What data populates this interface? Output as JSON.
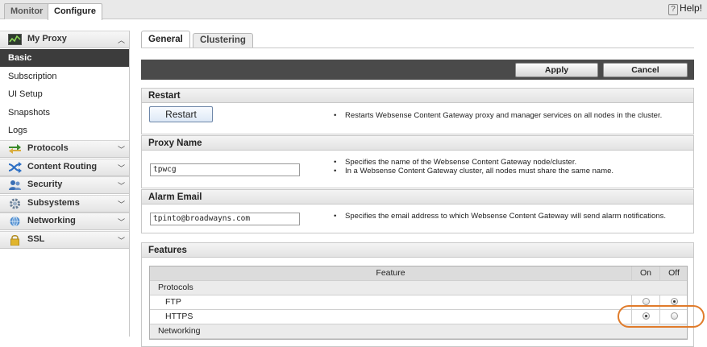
{
  "top_tabs": {
    "monitor": "Monitor",
    "configure": "Configure"
  },
  "help": {
    "label": "Help!"
  },
  "sidebar": {
    "my_proxy": "My Proxy",
    "items": [
      "Basic",
      "Subscription",
      "UI Setup",
      "Snapshots",
      "Logs"
    ],
    "sections": [
      "Protocols",
      "Content Routing",
      "Security",
      "Subsystems",
      "Networking",
      "SSL"
    ]
  },
  "tabs": {
    "general": "General",
    "clustering": "Clustering"
  },
  "toolbar": {
    "apply": "Apply",
    "cancel": "Cancel"
  },
  "restart": {
    "title": "Restart",
    "button": "Restart",
    "desc": "Restarts Websense Content Gateway proxy and manager services on all nodes in the cluster."
  },
  "proxy_name": {
    "title": "Proxy Name",
    "value": "tpwcg",
    "desc1": "Specifies the name of the Websense Content Gateway node/cluster.",
    "desc2": "In a Websense Content Gateway cluster, all nodes must share the same name."
  },
  "alarm_email": {
    "title": "Alarm Email",
    "value": "tpinto@broadwayns.com",
    "desc": "Specifies the email address to which Websense Content Gateway will send alarm notifications."
  },
  "features": {
    "title": "Features",
    "col_feature": "Feature",
    "col_on": "On",
    "col_off": "Off",
    "group_protocols": "Protocols",
    "rows": [
      {
        "name": "FTP",
        "on": false,
        "off": true
      },
      {
        "name": "HTTPS",
        "on": true,
        "off": false
      }
    ],
    "group_networking": "Networking"
  },
  "colors": {
    "highlight": "#e07b2a",
    "active_item": "#3c3c3c",
    "action_bar": "#4a4a4a"
  }
}
